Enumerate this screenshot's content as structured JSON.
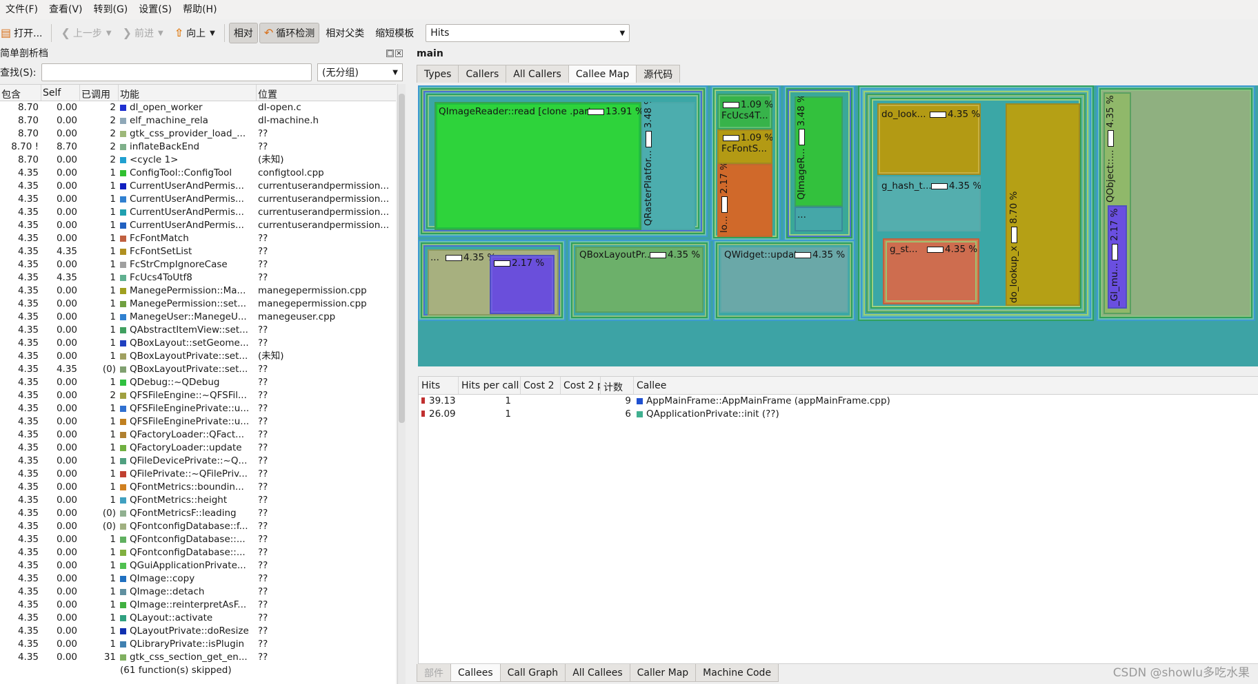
{
  "menu": [
    "文件(F)",
    "查看(V)",
    "转到(G)",
    "设置(S)",
    "帮助(H)"
  ],
  "toolbar": {
    "open": "打开...",
    "back": "上一步",
    "forward": "前进",
    "up": "向上",
    "relative": "相对",
    "cycle": "循环检测",
    "relative_parent": "相对父类",
    "shorten": "缩短模板",
    "event_select": "Hits"
  },
  "left": {
    "title": "简单剖析档",
    "search_label": "查找(S):",
    "search_value": "",
    "group_select": "(无分组)",
    "columns": [
      "包含",
      "Self",
      "已调用",
      "功能",
      "位置"
    ],
    "rows": [
      [
        "8.70",
        "0.00",
        "2",
        "dl_open_worker",
        "dl-open.c",
        "#1f30d0"
      ],
      [
        "8.70",
        "0.00",
        "2",
        "elf_machine_rela",
        "dl-machine.h",
        "#8fa8b8"
      ],
      [
        "8.70",
        "0.00",
        "2",
        "gtk_css_provider_load_...",
        "??",
        "#9db87a"
      ],
      [
        "8.70 !",
        "8.70",
        "2",
        "inflateBackEnd",
        "??",
        "#7fb08a"
      ],
      [
        "8.70",
        "0.00",
        "2",
        "<cycle 1>",
        "(未知)",
        "#20a0d0"
      ],
      [
        "4.35",
        "0.00",
        "1",
        "ConfigTool::ConfigTool",
        "configtool.cpp",
        "#30c030"
      ],
      [
        "4.35",
        "0.00",
        "1",
        "CurrentUserAndPermis...",
        "currentuserandpermission...",
        "#1020c0"
      ],
      [
        "4.35",
        "0.00",
        "1",
        "CurrentUserAndPermis...",
        "currentuserandpermission...",
        "#3080d0"
      ],
      [
        "4.35",
        "0.00",
        "1",
        "CurrentUserAndPermis...",
        "currentuserandpermission...",
        "#20a0b0"
      ],
      [
        "4.35",
        "0.00",
        "1",
        "CurrentUserAndPermis...",
        "currentuserandpermission...",
        "#2060c0"
      ],
      [
        "4.35",
        "0.00",
        "1",
        "FcFontMatch",
        "??",
        "#c06040"
      ],
      [
        "4.35",
        "4.35",
        "1",
        "FcFontSetList",
        "??",
        "#b09020"
      ],
      [
        "4.35",
        "0.00",
        "1",
        "FcStrCmpIgnoreCase",
        "??",
        "#a0a0a0"
      ],
      [
        "4.35",
        "4.35",
        "1",
        "FcUcs4ToUtf8",
        "??",
        "#60b090"
      ],
      [
        "4.35",
        "0.00",
        "1",
        "ManegePermission::Ma...",
        "manegepermission.cpp",
        "#a0a020"
      ],
      [
        "4.35",
        "0.00",
        "1",
        "ManegePermission::set...",
        "manegepermission.cpp",
        "#70a040"
      ],
      [
        "4.35",
        "0.00",
        "1",
        "ManegeUser::ManegeU...",
        "manegeuser.cpp",
        "#3080d0"
      ],
      [
        "4.35",
        "0.00",
        "1",
        "QAbstractItemView::set...",
        "??",
        "#40a060"
      ],
      [
        "4.35",
        "0.00",
        "1",
        "QBoxLayout::setGeome...",
        "??",
        "#2040c0"
      ],
      [
        "4.35",
        "0.00",
        "1",
        "QBoxLayoutPrivate::set...",
        "(未知)",
        "#a0a060"
      ],
      [
        "4.35",
        "4.35",
        "(0)",
        "QBoxLayoutPrivate::set...",
        "??",
        "#80a070"
      ],
      [
        "4.35",
        "0.00",
        "1",
        "QDebug::~QDebug",
        "??",
        "#30c040"
      ],
      [
        "4.35",
        "0.00",
        "2",
        "QFSFileEngine::~QFSFil...",
        "??",
        "#a0a040"
      ],
      [
        "4.35",
        "0.00",
        "1",
        "QFSFileEnginePrivate::u...",
        "??",
        "#3070d0"
      ],
      [
        "4.35",
        "0.00",
        "1",
        "QFSFileEnginePrivate::u...",
        "??",
        "#c08020"
      ],
      [
        "4.35",
        "0.00",
        "1",
        "QFactoryLoader::QFact...",
        "??",
        "#b08030"
      ],
      [
        "4.35",
        "0.00",
        "1",
        "QFactoryLoader::update",
        "??",
        "#70b040"
      ],
      [
        "4.35",
        "0.00",
        "1",
        "QFileDevicePrivate::~Q...",
        "??",
        "#50a080"
      ],
      [
        "4.35",
        "0.00",
        "1",
        "QFilePrivate::~QFilePriv...",
        "??",
        "#c04030"
      ],
      [
        "4.35",
        "0.00",
        "1",
        "QFontMetrics::boundin...",
        "??",
        "#d08020"
      ],
      [
        "4.35",
        "0.00",
        "1",
        "QFontMetrics::height",
        "??",
        "#40a0c0"
      ],
      [
        "4.35",
        "0.00",
        "(0)",
        "QFontMetricsF::leading",
        "??",
        "#90b090"
      ],
      [
        "4.35",
        "0.00",
        "(0)",
        "QFontconfigDatabase::f...",
        "??",
        "#a0b080"
      ],
      [
        "4.35",
        "0.00",
        "1",
        "QFontconfigDatabase::...",
        "??",
        "#60b060"
      ],
      [
        "4.35",
        "0.00",
        "1",
        "QFontconfigDatabase::...",
        "??",
        "#80b040"
      ],
      [
        "4.35",
        "0.00",
        "1",
        "QGuiApplicationPrivate...",
        "??",
        "#50c050"
      ],
      [
        "4.35",
        "0.00",
        "1",
        "QImage::copy",
        "??",
        "#2070c0"
      ],
      [
        "4.35",
        "0.00",
        "1",
        "QImage::detach",
        "??",
        "#6090a0"
      ],
      [
        "4.35",
        "0.00",
        "1",
        "QImage::reinterpretAsF...",
        "??",
        "#40b040"
      ],
      [
        "4.35",
        "0.00",
        "1",
        "QLayout::activate",
        "??",
        "#30a080"
      ],
      [
        "4.35",
        "0.00",
        "1",
        "QLayoutPrivate::doResize",
        "??",
        "#1030b0"
      ],
      [
        "4.35",
        "0.00",
        "1",
        "QLibraryPrivate::isPlugin",
        "??",
        "#4080b0"
      ],
      [
        "4.35",
        "0.00",
        "31",
        "gtk_css_section_get_en...",
        "??",
        "#80b060"
      ],
      [
        "",
        "",
        "",
        "(61 function(s) skipped)",
        "",
        ""
      ]
    ]
  },
  "right": {
    "function_name": "main",
    "tabs": [
      "Types",
      "Callers",
      "All Callers",
      "Callee Map",
      "源代码"
    ],
    "treemap_labels": {
      "qimagereader": "QImageReader::read [clone .part....",
      "qimagereader_pct": "13.91 %",
      "qrasterplatform": "QRasterPlatfor...",
      "qrasterplatform_pct": "3.48 %",
      "fcucs4": "FcUcs4T...",
      "fcucs4_pct": "1.09 %",
      "fcfonts": "FcFontS...",
      "fcfonts_pct": "1.09 %",
      "lo": "lo...",
      "lo_pct": "2.17 %",
      "qimager": "QImageR...",
      "qimager_pct": "3.48 %",
      "dots1": "...",
      "do_look": "do_look...",
      "do_look_pct": "4.35 %",
      "g_hash": "g_hash_t...",
      "g_hash_pct": "4.35 %",
      "g_st": "g_st...",
      "g_st_pct": "4.35 %",
      "do_lookup_x": "do_lookup_x",
      "do_lookup_x_pct": "8.70 %",
      "qobject": "QObject::...",
      "qobject_pct": "4.35 %",
      "gl_mu": "_Gl_mu...",
      "gl_mu_pct": "2.17 %",
      "dots2": "...",
      "dots2_pct": "4.35 %",
      "small_pct": "2.17 %",
      "qboxlayout": "QBoxLayoutPr...",
      "qboxlayout_pct": "4.35 %",
      "qwidget": "QWidget::update",
      "qwidget_pct": "4.35 %"
    },
    "callee_columns": [
      "Hits",
      "Hits per call",
      "Cost 2",
      "Cost 2 p",
      "计数",
      "Callee"
    ],
    "callee_rows": [
      {
        "hits": "39.13",
        "per_call": "1",
        "count": "9",
        "callee": "AppMainFrame::AppMainFrame (appMainFrame.cpp)",
        "bar": "#c03030",
        "sw": "#1f50d0"
      },
      {
        "hits": "26.09",
        "per_call": "1",
        "count": "6",
        "callee": "QApplicationPrivate::init (??)",
        "bar": "#c03030",
        "sw": "#40b090"
      }
    ],
    "bottom_tabs": [
      "部件",
      "Callees",
      "Call Graph",
      "All Callees",
      "Caller Map",
      "Machine Code"
    ]
  },
  "watermark": "CSDN @showlu多吃水果"
}
